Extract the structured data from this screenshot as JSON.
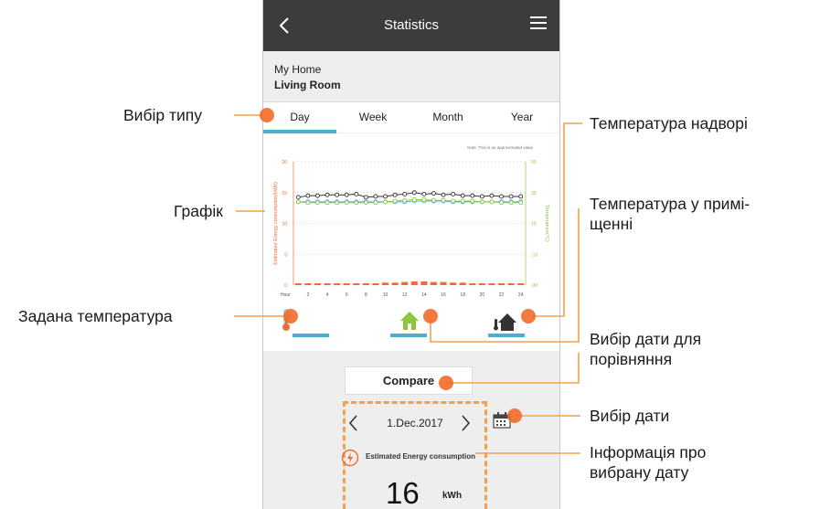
{
  "header": {
    "title": "Statistics"
  },
  "location": {
    "home": "My Home",
    "room": "Living Room"
  },
  "tabs": [
    "Day",
    "Week",
    "Month",
    "Year"
  ],
  "selected_tab": "Day",
  "chart_note": "Note: This is an approximated value",
  "chart_data": {
    "type": "line",
    "x_label": "Hour",
    "x_ticks": [
      "2",
      "4",
      "6",
      "8",
      "10",
      "12",
      "14",
      "16",
      "18",
      "20",
      "22",
      "24"
    ],
    "x": [
      1,
      2,
      3,
      4,
      5,
      6,
      7,
      8,
      9,
      10,
      11,
      12,
      13,
      14,
      15,
      16,
      17,
      18,
      19,
      20,
      21,
      22,
      23,
      24
    ],
    "y_left_label": "Estimated Energy consumption(kWh)",
    "y_left_ticks": [
      "20",
      "15",
      "10",
      "5",
      "0"
    ],
    "y_left_range": [
      0,
      20
    ],
    "y_right_label": "Temperature(°C)",
    "y_right_ticks": [
      "50",
      "30",
      "10",
      "-10",
      "-30"
    ],
    "y_right_range": [
      -30,
      50
    ],
    "series": [
      {
        "axis": "right",
        "color": "#333333",
        "values": [
          27,
          28,
          28,
          28.5,
          28.5,
          28.5,
          29,
          27,
          27.5,
          27.5,
          28.5,
          29,
          30,
          29,
          29.5,
          28.5,
          29,
          28,
          28,
          27.5,
          28,
          27.5,
          27.5,
          27.5
        ]
      },
      {
        "axis": "right",
        "color": "#4ab0d0",
        "values": [
          24,
          24,
          24,
          24,
          24,
          24,
          24,
          24,
          24,
          24,
          24,
          24,
          24.5,
          24.5,
          24.5,
          24.5,
          24,
          24,
          24,
          24,
          24,
          24,
          24,
          24
        ]
      },
      {
        "axis": "right",
        "color": "#8cc63f",
        "values": [
          24,
          23.5,
          23.5,
          23.5,
          23.5,
          23.5,
          23.5,
          23.5,
          23.5,
          24,
          24.5,
          25,
          25.5,
          25.5,
          25,
          25,
          24.5,
          24.5,
          24.5,
          24,
          24,
          23.5,
          23.5,
          23.5
        ]
      },
      {
        "axis": "left",
        "type": "bar",
        "color": "#f06a35",
        "values": [
          0.3,
          0.3,
          0.3,
          0.3,
          0.3,
          0.3,
          0.3,
          0.3,
          0.3,
          0.4,
          0.4,
          0.5,
          0.6,
          0.6,
          0.5,
          0.5,
          0.4,
          0.4,
          0.3,
          0.3,
          0.3,
          0.3,
          0.3,
          0.3
        ]
      }
    ]
  },
  "legend_icons": [
    "thermometer-icon",
    "indoor-house-icon",
    "outdoor-house-icon"
  ],
  "compare_label": "Compare",
  "date": "1.Dec.2017",
  "energy_label": "Estimated Energy consumption",
  "energy_value": "16",
  "energy_unit": "kWh",
  "callouts": {
    "type_select": "Вибір типу",
    "chart": "Графік",
    "set_temp": "Задана температура",
    "outdoor_temp": "Температура надворі",
    "indoor_temp_line1": "Температура у примі-",
    "indoor_temp_line2": "щенні",
    "compare_line1": "Вибір дати для",
    "compare_line2": "порівняння",
    "date_select": "Вибір дати",
    "date_info_line1": "Інформація про",
    "date_info_line2": "вибрану дату"
  },
  "colors": {
    "accent": "#4ab0d0",
    "callout_orange": "#f5a04a",
    "energy_orange": "#f06a35",
    "indoor_green": "#8cc63f",
    "appbar": "#3c3c3c"
  }
}
